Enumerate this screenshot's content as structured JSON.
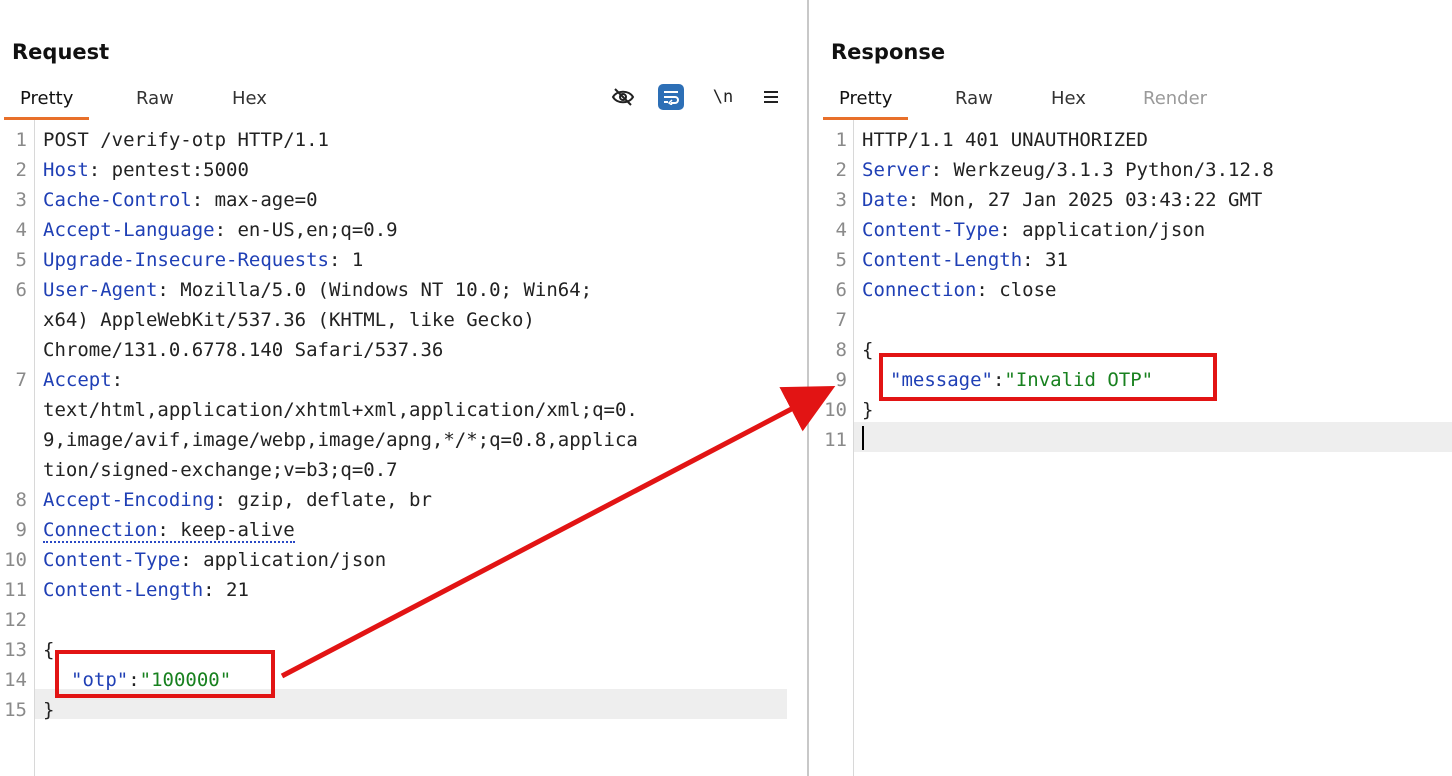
{
  "request": {
    "title": "Request",
    "tabs": [
      {
        "label": "Pretty",
        "active": true
      },
      {
        "label": "Raw",
        "active": false
      },
      {
        "label": "Hex",
        "active": false
      }
    ],
    "toolbar": {
      "hide_icon": "eye-slash-icon",
      "wrap_icon": "wrap-lines-icon",
      "newline_label": "\\n",
      "menu_icon": "hamburger-menu-icon"
    },
    "line_numbers": [
      "1",
      "2",
      "3",
      "4",
      "5",
      "6",
      "",
      "",
      "7",
      "",
      "",
      "",
      "8",
      "9",
      "10",
      "11",
      "12",
      "13",
      "14",
      "15"
    ],
    "lines": [
      {
        "text": "POST /verify-otp HTTP/1.1"
      },
      {
        "key": "Host",
        "value": ": pentest:5000"
      },
      {
        "key": "Cache-Control",
        "value": ": max-age=0"
      },
      {
        "key": "Accept-Language",
        "value": ": en-US,en;q=0.9"
      },
      {
        "key": "Upgrade-Insecure-Requests",
        "value": ": 1"
      },
      {
        "key": "User-Agent",
        "value": ": Mozilla/5.0 (Windows NT 10.0; Win64;"
      },
      {
        "text": "x64) AppleWebKit/537.36 (KHTML, like Gecko)"
      },
      {
        "text": "Chrome/131.0.6778.140 Safari/537.36"
      },
      {
        "key": "Accept",
        "value": ":"
      },
      {
        "text": "text/html,application/xhtml+xml,application/xml;q=0."
      },
      {
        "text": "9,image/avif,image/webp,image/apng,*/*;q=0.8,applica"
      },
      {
        "text": "tion/signed-exchange;v=b3;q=0.7"
      },
      {
        "key": "Accept-Encoding",
        "value": ": gzip, deflate, br"
      },
      {
        "key": "Connection",
        "value": ": keep-alive"
      },
      {
        "key": "Content-Type",
        "value": ": application/json"
      },
      {
        "key": "Content-Length",
        "value": ": 21"
      },
      {
        "text": ""
      },
      {
        "text": "{"
      },
      {
        "jkey": "\"otp\"",
        "sep": ":",
        "jval": "\"100000\""
      },
      {
        "text": "}"
      }
    ]
  },
  "response": {
    "title": "Response",
    "tabs": [
      {
        "label": "Pretty",
        "active": true
      },
      {
        "label": "Raw",
        "active": false
      },
      {
        "label": "Hex",
        "active": false
      },
      {
        "label": "Render",
        "active": false
      }
    ],
    "line_numbers": [
      "1",
      "2",
      "3",
      "4",
      "5",
      "6",
      "7",
      "8",
      "9",
      "10",
      "11"
    ],
    "lines": [
      {
        "text": "HTTP/1.1 401 UNAUTHORIZED"
      },
      {
        "key": "Server",
        "value": ": Werkzeug/3.1.3 Python/3.12.8"
      },
      {
        "key": "Date",
        "value": ": Mon, 27 Jan 2025 03:43:22 GMT"
      },
      {
        "key": "Content-Type",
        "value": ": application/json"
      },
      {
        "key": "Content-Length",
        "value": ": 31"
      },
      {
        "key": "Connection",
        "value": ": close"
      },
      {
        "text": ""
      },
      {
        "text": "{"
      },
      {
        "jkey": "\"message\"",
        "sep": ":",
        "jval": "\"Invalid OTP\""
      },
      {
        "text": "}"
      },
      {
        "text": ""
      }
    ]
  },
  "annotation": {
    "color": "#e21414"
  }
}
